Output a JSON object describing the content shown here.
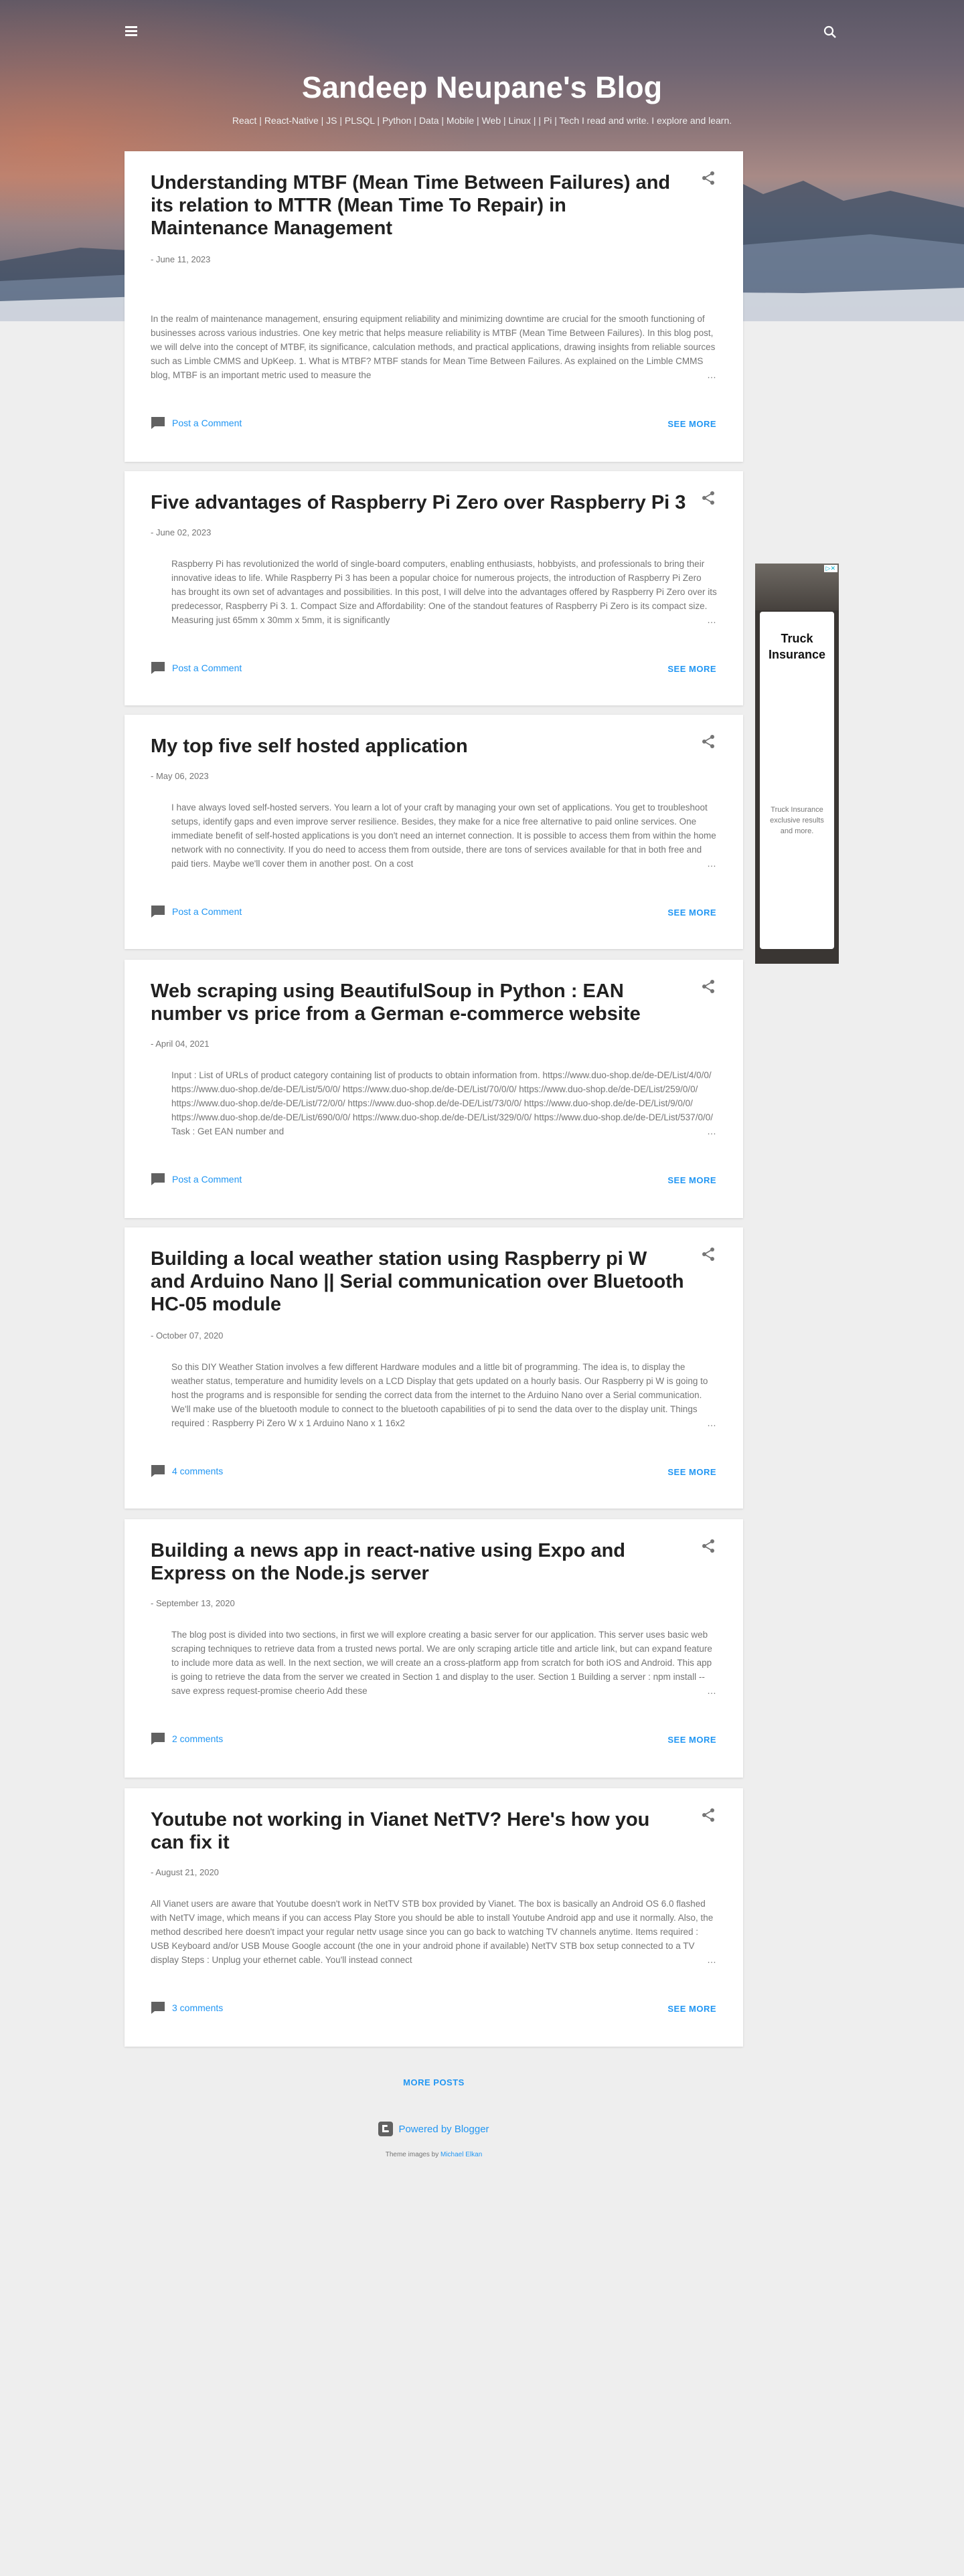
{
  "header": {
    "title": "Sandeep Neupane's Blog",
    "description": "React | React-Native | JS | PLSQL | Python | Data | Mobile | Web | Linux | | Pi | Tech I read and write. I explore and learn.",
    "menu_icon": "hamburger-menu-icon",
    "search_icon": "search-icon"
  },
  "posts": [
    {
      "title": "Understanding MTBF (Mean Time Between Failures) and its relation to MTTR (Mean Time To Repair) in Maintenance Management",
      "date": "- June 11, 2023",
      "snippet": "In the realm of maintenance management, ensuring equipment reliability and minimizing downtime are crucial for the smooth functioning of businesses across various industries. One key metric that helps measure reliability is MTBF (Mean Time Between Failures). In this blog post, we will delve into the concept of MTBF, its significance, calculation methods, and practical applications, drawing insights from reliable sources such as Limble CMMS and UpKeep. 1. What is MTBF? MTBF stands for Mean Time Between Failures. As explained on the Limble CMMS blog, MTBF is an important metric used to measure the",
      "comments": "Post a Comment",
      "see_more": "SEE MORE"
    },
    {
      "title": "Five advantages of Raspberry Pi Zero over Raspberry Pi 3",
      "date": "- June 02, 2023",
      "snippet": "Raspberry Pi has revolutionized the world of single-board computers, enabling enthusiasts, hobbyists, and professionals to bring their innovative ideas to life. While Raspberry Pi 3 has been a popular choice for numerous projects, the introduction of Raspberry Pi Zero has brought its own set of advantages and possibilities. In this post, I will delve into the advantages offered by Raspberry Pi Zero over its predecessor, Raspberry Pi 3. 1. Compact Size and Affordability: One of the standout features of Raspberry Pi Zero is its compact size. Measuring just 65mm x 30mm x 5mm, it is significantly",
      "comments": "Post a Comment",
      "see_more": "SEE MORE"
    },
    {
      "title": "My top five self hosted application",
      "date": "- May 06, 2023",
      "snippet": "I have always loved self-hosted servers. You learn a lot of your craft by managing your own set of applications. You get to troubleshoot setups, identify gaps and even improve server resilience. Besides, they make for a nice free alternative to paid online services. One immediate benefit of self-hosted applications is you don't need an internet connection. It is possible to access them from within the home network with no connectivity. If you do need to access them from outside, there are tons of services available for that in both free and paid tiers. Maybe we'll cover them in another post. On a cost",
      "comments": "Post a Comment",
      "see_more": "SEE MORE"
    },
    {
      "title": "Web scraping using BeautifulSoup in Python : EAN number vs price from a German e-commerce website",
      "date": "- April 04, 2021",
      "snippet": "Input : List of URLs of product category containing list of products to obtain information from. https://www.duo-shop.de/de-DE/List/4/0/0/ https://www.duo-shop.de/de-DE/List/5/0/0/ https://www.duo-shop.de/de-DE/List/70/0/0/ https://www.duo-shop.de/de-DE/List/259/0/0/ https://www.duo-shop.de/de-DE/List/72/0/0/ https://www.duo-shop.de/de-DE/List/73/0/0/ https://www.duo-shop.de/de-DE/List/9/0/0/ https://www.duo-shop.de/de-DE/List/690/0/0/ https://www.duo-shop.de/de-DE/List/329/0/0/ https://www.duo-shop.de/de-DE/List/537/0/0/ Task : Get EAN number and",
      "comments": "Post a Comment",
      "see_more": "SEE MORE"
    },
    {
      "title": "Building a local weather station using Raspberry pi W and Arduino Nano || Serial communication over Bluetooth HC-05 module",
      "date": "- October 07, 2020",
      "snippet": "So this DIY Weather Station involves a few different Hardware modules and a little bit of programming. The idea is, to display the weather status, temperature and humidity levels on a LCD Display that gets updated on a hourly basis. Our Raspberry pi W is going to host the programs and is responsible for sending the correct data from the internet to the Arduino Nano over a Serial communication. We'll make use of the bluetooth module to connect to the bluetooth capabilities of pi to send the data over to the display unit. Things required : Raspberry Pi Zero W x 1 Arduino Nano x 1 16x2",
      "comments": "4 comments",
      "see_more": "SEE MORE"
    },
    {
      "title": "Building a news app in react-native using Expo and Express on the Node.js server",
      "date": "- September 13, 2020",
      "snippet": "The blog post is divided into two sections, in first we will explore creating a basic server for our application. This server uses basic web scraping techniques to retrieve data from a trusted news portal. We are only scraping article title and article link, but can expand feature to include more data as well. In the next section, we will create an a cross-platform app from scratch for both iOS and Android. This app is going to retrieve the data from the server we created in Section 1 and display to the user. Section 1 Building a server : npm install --save express request-promise cheerio Add these",
      "comments": "2 comments",
      "see_more": "SEE MORE"
    },
    {
      "title": "Youtube not working in Vianet NetTV? Here's how you can fix it",
      "date": "- August 21, 2020",
      "snippet": "All Vianet users are aware that Youtube doesn't work in NetTV STB box provided by Vianet. The box is basically an Android OS 6.0 flashed with NetTV image, which means if you can access Play Store you should be able to install Youtube Android app and use it normally. Also, the method described here doesn't impact your regular nettv usage since you can go back to watching TV channels anytime. Items required : USB Keyboard and/or USB Mouse Google account (the one in your android phone if available) NetTV STB box setup connected to a TV display Steps : Unplug your ethernet cable. You'll instead connect",
      "comments": "3 comments",
      "see_more": "SEE MORE"
    }
  ],
  "ad": {
    "title": "Truck Insurance",
    "text": "Truck Insurance exclusive results and more.",
    "badge": "▷✕"
  },
  "footer": {
    "more_posts": "MORE POSTS",
    "powered_by": "Powered by Blogger",
    "theme_prefix": "Theme images by",
    "theme_author": "Michael Elkan"
  },
  "colors": {
    "accent": "#2196f3",
    "muted": "#757575",
    "background": "#eeeeee"
  }
}
